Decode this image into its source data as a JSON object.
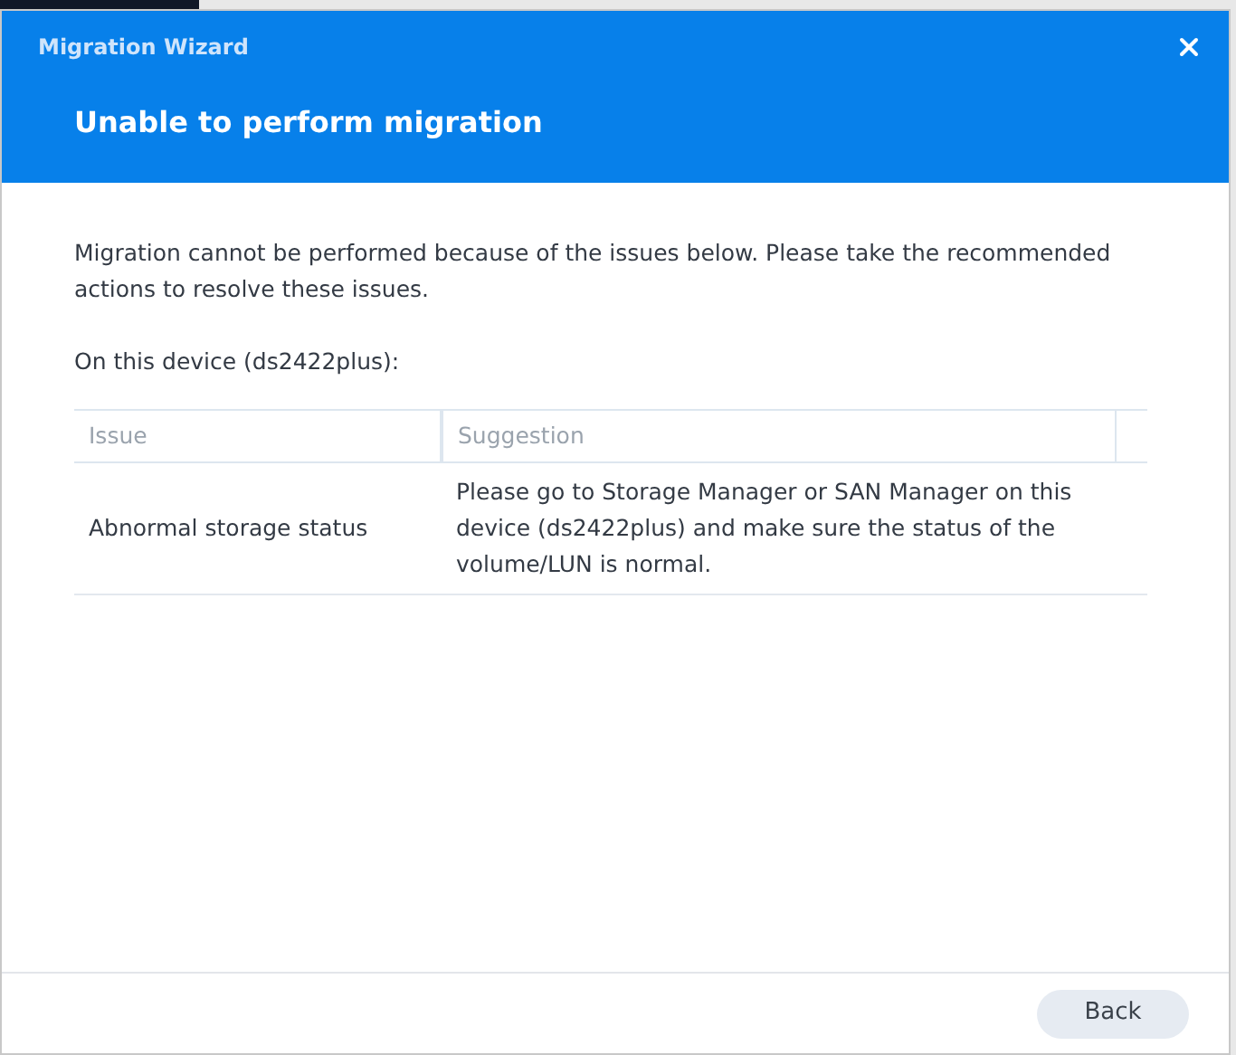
{
  "window": {
    "title": "Migration Wizard"
  },
  "heading": "Unable to perform migration",
  "message": "Migration cannot be performed because of the issues below. Please take the recommended actions to resolve these issues.",
  "device_label": "On this device (ds2422plus):",
  "table": {
    "columns": [
      "Issue",
      "Suggestion"
    ],
    "rows": [
      {
        "issue": "Abnormal storage status",
        "suggestion": "Please go to Storage Manager or SAN Manager on this device (ds2422plus) and make sure the status of the volume/LUN is normal."
      }
    ]
  },
  "buttons": [
    "Back"
  ]
}
